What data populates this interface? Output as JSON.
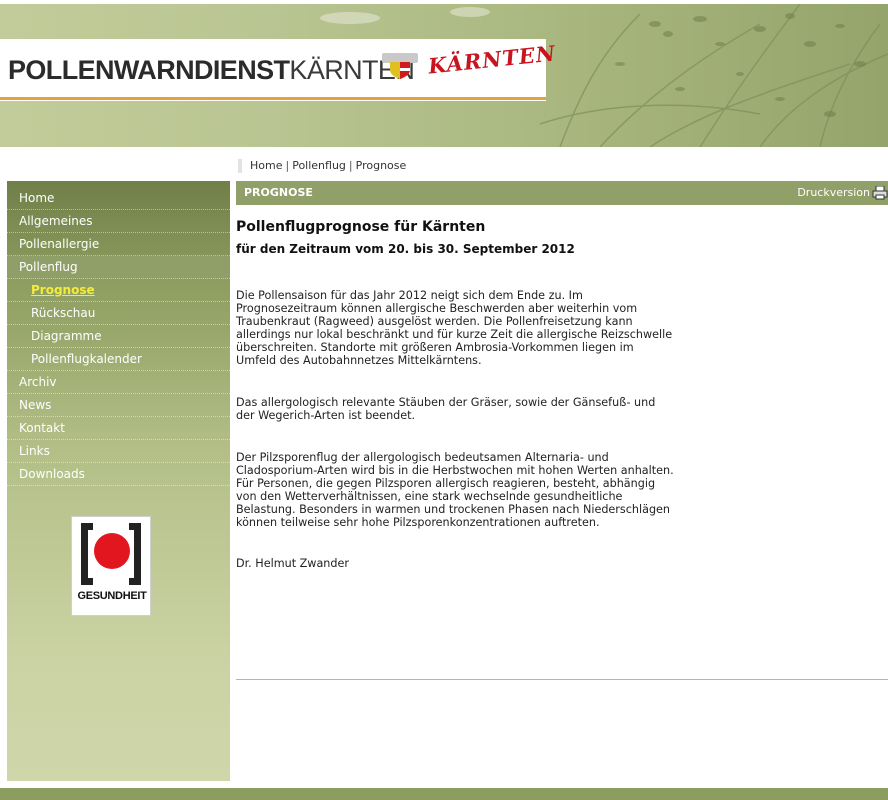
{
  "header": {
    "logo_bold": "POLLENWARNDIENST",
    "logo_light": "KÄRNTEN",
    "brand": "KÄRNTEN"
  },
  "breadcrumb": {
    "items": [
      "Home",
      "Pollenflug",
      "Prognose"
    ]
  },
  "sidebar": {
    "items": [
      {
        "label": "Home"
      },
      {
        "label": "Allgemeines"
      },
      {
        "label": "Pollenallergie"
      },
      {
        "label": "Pollenflug",
        "active": true
      },
      {
        "label": "Prognose",
        "current": true
      },
      {
        "label": "Rückschau"
      },
      {
        "label": "Diagramme"
      },
      {
        "label": "Pollenflugkalender"
      },
      {
        "label": "Archiv"
      },
      {
        "label": "News"
      },
      {
        "label": "Kontakt"
      },
      {
        "label": "Links"
      },
      {
        "label": "Downloads"
      }
    ],
    "badge": "GESUNDHEIT"
  },
  "content": {
    "section_title": "PROGNOSE",
    "print_label": "Druckversion",
    "heading": "Pollenflugprognose für Kärnten",
    "subheading": "für den Zeitraum vom 20. bis 30. September 2012",
    "paragraphs": [
      "Die Pollensaison für das Jahr 2012 neigt sich dem Ende zu. Im Prognosezeitraum können allergische Beschwerden aber weiterhin vom Traubenkraut (Ragweed) ausgelöst werden. Die Pollenfreisetzung kann allerdings nur lokal beschränkt und für kurze Zeit die allergische Reizschwelle überschreiten. Standorte mit größeren Ambrosia-Vorkommen liegen im Umfeld des Autobahnnetzes Mittelkärntens.",
      "Das allergologisch relevante Stäuben der Gräser, sowie der Gänsefuß- und der Wegerich-Arten ist beendet.",
      "Der Pilzsporenflug der allergologisch bedeutsamen Alternaria- und Cladosporium-Arten wird bis in die Herbstwochen mit hohen Werten anhalten. Für Personen, die gegen Pilzsporen allergisch reagieren, besteht, abhängig von den Wetterverhältnissen, eine stark wechselnde gesundheitliche Belastung. Besonders in warmen und trockenen Phasen nach Niederschlägen können teilweise sehr hohe Pilzsporenkonzentrationen auftreten."
    ],
    "signature": "Dr. Helmut Zwander"
  },
  "colors": {
    "nav_green": "#919f68",
    "current_link": "#f4ec3c",
    "logo_rule": "#e6a23a",
    "brand_red": "#c8141e"
  }
}
